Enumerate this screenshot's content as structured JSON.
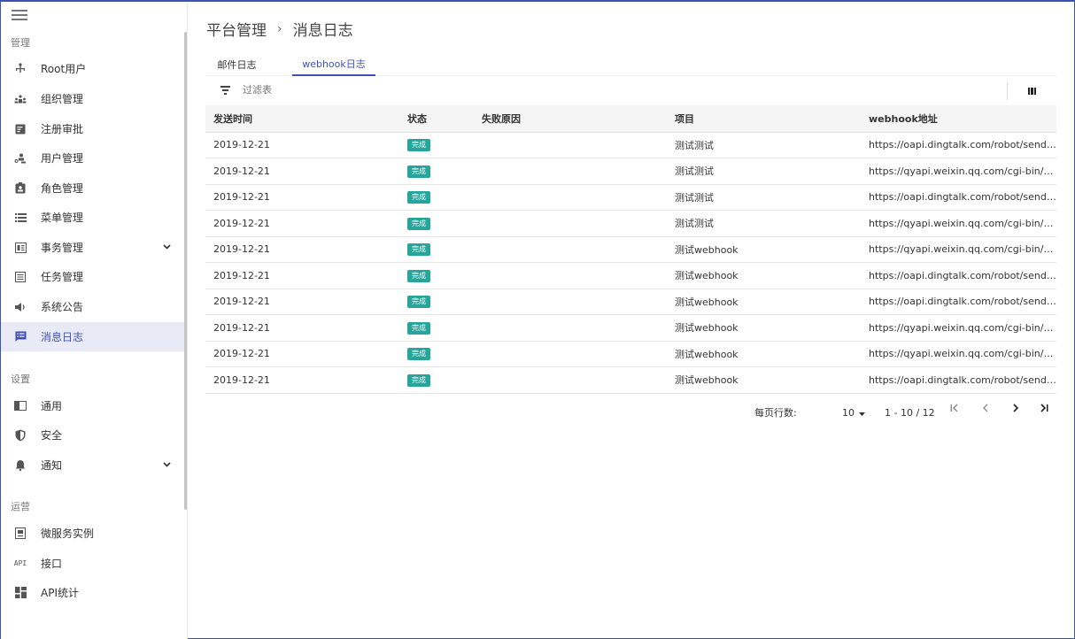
{
  "sidebar": {
    "sections": [
      "管理",
      "设置",
      "运营"
    ],
    "items": [
      {
        "label": "Root用户",
        "icon": "user-tree-icon"
      },
      {
        "label": "组织管理",
        "icon": "organization-icon"
      },
      {
        "label": "注册审批",
        "icon": "approval-icon"
      },
      {
        "label": "用户管理",
        "icon": "users-icon"
      },
      {
        "label": "角色管理",
        "icon": "role-badge-icon"
      },
      {
        "label": "菜单管理",
        "icon": "menu-list-icon"
      },
      {
        "label": "事务管理",
        "icon": "transaction-icon"
      },
      {
        "label": "任务管理",
        "icon": "task-icon"
      },
      {
        "label": "系统公告",
        "icon": "megaphone-icon"
      },
      {
        "label": "消息日志",
        "icon": "message-log-icon"
      },
      {
        "label": "通用",
        "icon": "general-icon"
      },
      {
        "label": "安全",
        "icon": "shield-icon"
      },
      {
        "label": "通知",
        "icon": "bell-icon"
      },
      {
        "label": "微服务实例",
        "icon": "microservice-icon"
      },
      {
        "label": "接口",
        "icon": "api-icon"
      },
      {
        "label": "API统计",
        "icon": "dashboard-icon"
      }
    ],
    "api_icon_text": "API",
    "active": "消息日志"
  },
  "breadcrumb": {
    "parent": "平台管理",
    "separator": "›",
    "current": "消息日志"
  },
  "tabs": [
    {
      "label": "邮件日志"
    },
    {
      "label": "webhook日志"
    }
  ],
  "active_tab": "webhook日志",
  "filter": {
    "placeholder": "过滤表"
  },
  "table": {
    "headers": [
      "发送时间",
      "状态",
      "失败原因",
      "项目",
      "webhook地址"
    ],
    "rows": [
      {
        "time": "2019-12-21",
        "status": "完成",
        "reason": "",
        "project": "测试测试",
        "url": "https://oapi.dingtalk.com/robot/send?a..."
      },
      {
        "time": "2019-12-21",
        "status": "完成",
        "reason": "",
        "project": "测试测试",
        "url": "https://qyapi.weixin.qq.com/cgi-bin/we..."
      },
      {
        "time": "2019-12-21",
        "status": "完成",
        "reason": "",
        "project": "测试测试",
        "url": "https://oapi.dingtalk.com/robot/send?a..."
      },
      {
        "time": "2019-12-21",
        "status": "完成",
        "reason": "",
        "project": "测试测试",
        "url": "https://qyapi.weixin.qq.com/cgi-bin/we..."
      },
      {
        "time": "2019-12-21",
        "status": "完成",
        "reason": "",
        "project": "测试webhook",
        "url": "https://qyapi.weixin.qq.com/cgi-bin/we..."
      },
      {
        "time": "2019-12-21",
        "status": "完成",
        "reason": "",
        "project": "测试webhook",
        "url": "https://oapi.dingtalk.com/robot/send?a..."
      },
      {
        "time": "2019-12-21",
        "status": "完成",
        "reason": "",
        "project": "测试webhook",
        "url": "https://oapi.dingtalk.com/robot/send?a..."
      },
      {
        "time": "2019-12-21",
        "status": "完成",
        "reason": "",
        "project": "测试webhook",
        "url": "https://qyapi.weixin.qq.com/cgi-bin/we..."
      },
      {
        "time": "2019-12-21",
        "status": "完成",
        "reason": "",
        "project": "测试webhook",
        "url": "https://qyapi.weixin.qq.com/cgi-bin/we..."
      },
      {
        "time": "2019-12-21",
        "status": "完成",
        "reason": "",
        "project": "测试webhook",
        "url": "https://oapi.dingtalk.com/robot/send?a..."
      }
    ]
  },
  "pagination": {
    "rows_per_page_label": "每页行数:",
    "rows_per_page": "10",
    "range": "1 - 10 / 12"
  },
  "colors": {
    "accent": "#3f51b5",
    "status_done": "#26a69a",
    "active_bg": "#e8eaf6"
  }
}
